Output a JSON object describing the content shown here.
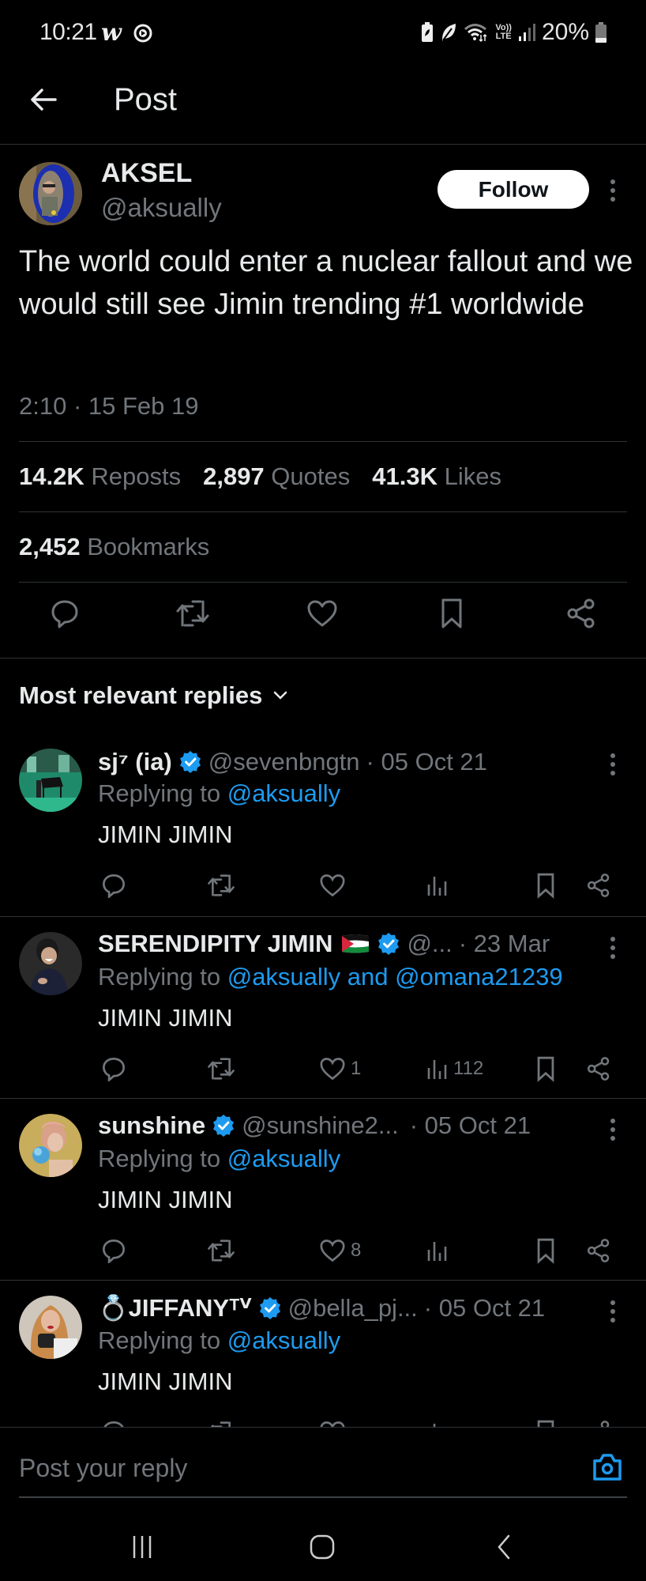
{
  "status_bar": {
    "time": "10:21",
    "app_glyph": "w",
    "battery_percent": "20%",
    "network": {
      "volte": "Vo))",
      "lte": "LTE"
    },
    "icons": [
      "webtoon-icon",
      "record-icon",
      "battery-saver-icon",
      "eco-leaf-icon",
      "wifi-icon",
      "volte-icon",
      "signal-icon",
      "battery-icon"
    ]
  },
  "header": {
    "title": "Post",
    "back_icon": "arrow-left-icon"
  },
  "post": {
    "author": {
      "name": "AKSEL",
      "handle": "@aksually"
    },
    "follow_label": "Follow",
    "text": "The world could enter a nuclear fallout and we would still see Jimin trending #1 worldwide",
    "timestamp": "2:10 · 15 Feb 19",
    "stats": {
      "reposts": {
        "value": "14.2K",
        "label": "Reposts"
      },
      "quotes": {
        "value": "2,897",
        "label": "Quotes"
      },
      "likes": {
        "value": "41.3K",
        "label": "Likes"
      },
      "bookmarks": {
        "value": "2,452",
        "label": "Bookmarks"
      }
    },
    "actions": [
      "reply-icon",
      "repost-icon",
      "like-icon",
      "bookmark-icon",
      "share-icon"
    ]
  },
  "replies_sort": {
    "label": "Most relevant replies"
  },
  "replies": [
    {
      "name": "sj⁷ (ia)",
      "verified": true,
      "flag": false,
      "handle": "@sevenbngtn",
      "date": "· 05 Oct 21",
      "replying_prefix": "Replying to ",
      "replying_to": "@aksually",
      "text": "JIMIN JIMIN",
      "likes": "",
      "views": ""
    },
    {
      "name": "SERENDIPITY JIMIN",
      "verified": true,
      "flag": true,
      "handle": "@...",
      "date": "· 23 Mar",
      "replying_prefix": "Replying to ",
      "replying_to": "@aksually and @omana21239",
      "text": "JIMIN JIMIN",
      "likes": "1",
      "views": "112"
    },
    {
      "name": "sunshine",
      "verified": true,
      "flag": false,
      "handle": "@sunshine2...",
      "date": " · 05 Oct 21",
      "replying_prefix": "Replying to ",
      "replying_to": "@aksually",
      "text": "JIMIN JIMIN",
      "likes": "8",
      "views": ""
    },
    {
      "name": "💍JIFFANYᵀⱽ",
      "verified": true,
      "flag": false,
      "handle": "@bella_pj...",
      "date": "· 05 Oct 21",
      "replying_prefix": "Replying to ",
      "replying_to": "@aksually",
      "text": "JIMIN JIMIN",
      "likes": "",
      "views": ""
    }
  ],
  "composer": {
    "placeholder": "Post your reply",
    "value": ""
  },
  "colors": {
    "background": "#000000",
    "text_primary": "#e7e9ea",
    "text_secondary": "#71767b",
    "link": "#1d9bf0",
    "divider": "#2f3336",
    "verified": "#1d9bf0",
    "follow_bg": "#ffffff"
  },
  "nav_bar": {
    "buttons": [
      "recent-apps",
      "home",
      "back"
    ]
  }
}
